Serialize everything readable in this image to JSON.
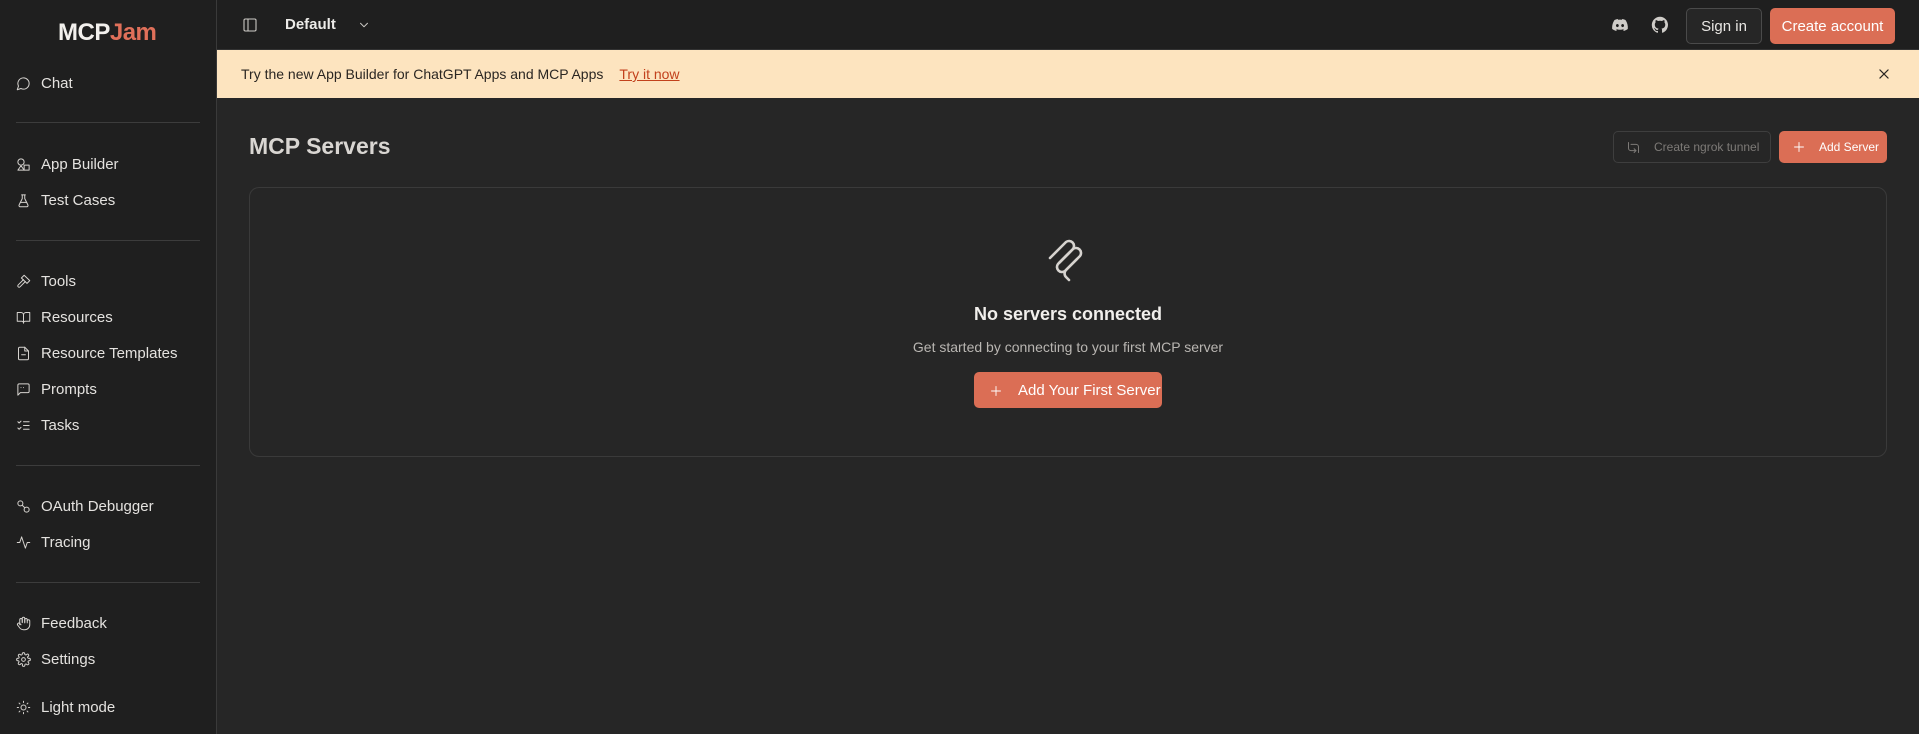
{
  "brand": {
    "name_part1": "MCP",
    "name_part2": "Jam"
  },
  "sidebar": {
    "items": [
      {
        "label": "Chat",
        "icon": "chat-bubble-icon"
      },
      {
        "label": "App Builder",
        "icon": "app-builder-icon"
      },
      {
        "label": "Test Cases",
        "icon": "flask-icon"
      },
      {
        "label": "Tools",
        "icon": "hammer-icon"
      },
      {
        "label": "Resources",
        "icon": "book-icon"
      },
      {
        "label": "Resource Templates",
        "icon": "file-template-icon"
      },
      {
        "label": "Prompts",
        "icon": "message-square-icon"
      },
      {
        "label": "Tasks",
        "icon": "list-checks-icon"
      },
      {
        "label": "OAuth Debugger",
        "icon": "key-link-icon"
      },
      {
        "label": "Tracing",
        "icon": "activity-icon"
      },
      {
        "label": "Feedback",
        "icon": "hand-icon"
      },
      {
        "label": "Settings",
        "icon": "gear-icon"
      },
      {
        "label": "Light mode",
        "icon": "sun-icon"
      }
    ]
  },
  "header": {
    "workspace": "Default",
    "sign_in": "Sign in",
    "create_account": "Create account"
  },
  "banner": {
    "text": "Try the new App Builder for ChatGPT Apps and MCP Apps",
    "link": "Try it now"
  },
  "main": {
    "title": "MCP Servers",
    "ngrok_button": "Create ngrok tunnel",
    "add_server_button": "Add Server",
    "empty": {
      "title": "No servers connected",
      "subtitle": "Get started by connecting to your first MCP server",
      "button": "Add Your First Server"
    }
  },
  "colors": {
    "accent": "#db6e55",
    "banner_bg": "#fde4bf",
    "sidebar_bg": "#1f1f1f",
    "page_bg": "#262626"
  }
}
